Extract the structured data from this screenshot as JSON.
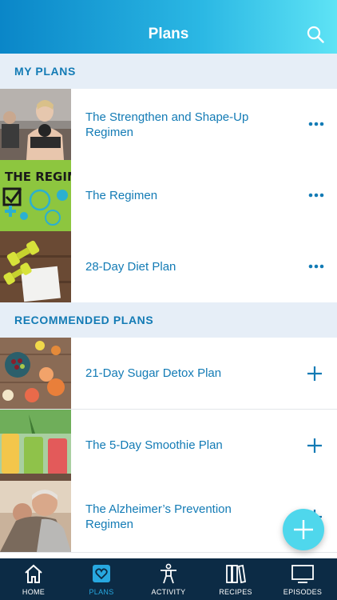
{
  "header": {
    "title": "Plans",
    "search_icon": "search-icon"
  },
  "sections": {
    "my_plans": "MY PLANS",
    "recommended": "RECOMMENDED PLANS"
  },
  "my_plans": [
    {
      "title": "The Strengthen and Shape-Up Regimen",
      "action_icon": "more-icon"
    },
    {
      "title": "The Regimen",
      "action_icon": "more-icon"
    },
    {
      "title": "28-Day Diet Plan",
      "action_icon": "more-icon"
    }
  ],
  "recommended_plans": [
    {
      "title": "21-Day Sugar Detox Plan",
      "action_icon": "add-icon"
    },
    {
      "title": "The 5-Day Smoothie Plan",
      "action_icon": "add-icon"
    },
    {
      "title": "The Alzheimer’s Prevention Regimen",
      "action_icon": "add-icon"
    }
  ],
  "thumb2_text": "THE REGIMEN",
  "tabs": [
    {
      "label": "HOME",
      "icon": "home-icon"
    },
    {
      "label": "PLANS",
      "icon": "heart-icon",
      "active": true
    },
    {
      "label": "ACTIVITY",
      "icon": "person-icon"
    },
    {
      "label": "RECIPES",
      "icon": "books-icon"
    },
    {
      "label": "EPISODES",
      "icon": "tv-icon"
    }
  ],
  "colors": {
    "accent": "#137bb5",
    "tabbar": "#0c2b45",
    "active_tab": "#27a8e0",
    "fab": "#4fd7ec"
  }
}
